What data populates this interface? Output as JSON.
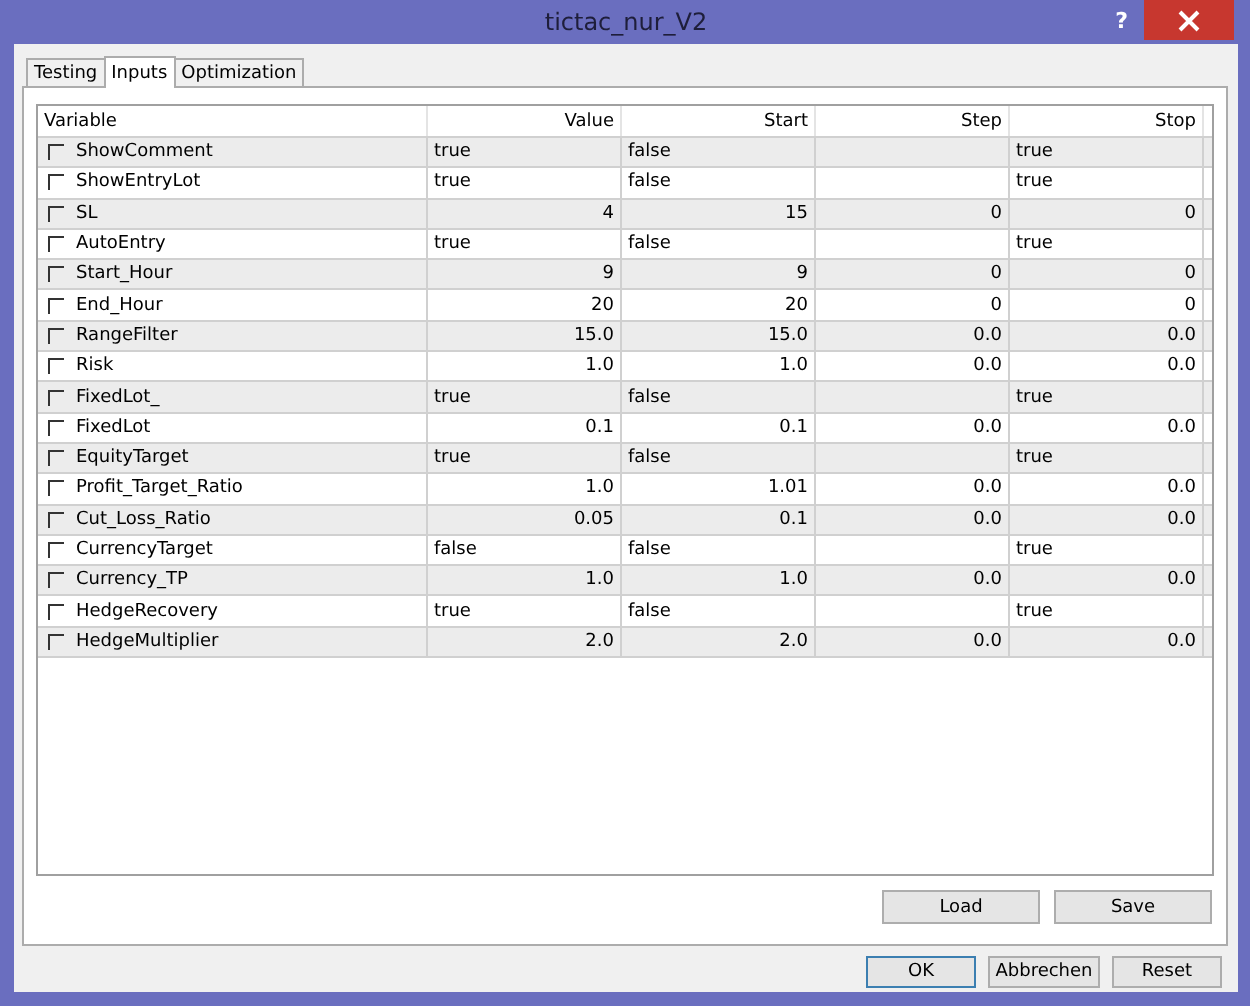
{
  "window": {
    "title": "tictac_nur_V2",
    "help": "?"
  },
  "tabs": [
    {
      "label": "Testing",
      "selected": false
    },
    {
      "label": "Inputs",
      "selected": true
    },
    {
      "label": "Optimization",
      "selected": false
    }
  ],
  "table": {
    "columns": [
      "Variable",
      "Value",
      "Start",
      "Step",
      "Stop"
    ],
    "rows": [
      {
        "kind": "bool",
        "checked": false,
        "variable": "ShowComment",
        "value": "true",
        "start": "false",
        "stop": "true"
      },
      {
        "kind": "bool",
        "checked": false,
        "variable": "ShowEntryLot",
        "value": "true",
        "start": "false",
        "stop": "true"
      },
      {
        "kind": "number",
        "checked": false,
        "variable": "SL",
        "value": "4",
        "start": "15",
        "step": "0",
        "stop": "0"
      },
      {
        "kind": "bool",
        "checked": false,
        "variable": "AutoEntry",
        "value": "true",
        "start": "false",
        "stop": "true"
      },
      {
        "kind": "number",
        "checked": false,
        "variable": "Start_Hour",
        "value": "9",
        "start": "9",
        "step": "0",
        "stop": "0"
      },
      {
        "kind": "number",
        "checked": false,
        "variable": "End_Hour",
        "value": "20",
        "start": "20",
        "step": "0",
        "stop": "0"
      },
      {
        "kind": "number",
        "checked": false,
        "variable": "RangeFilter",
        "value": "15.0",
        "start": "15.0",
        "step": "0.0",
        "stop": "0.0"
      },
      {
        "kind": "number",
        "checked": false,
        "variable": "Risk",
        "value": "1.0",
        "start": "1.0",
        "step": "0.0",
        "stop": "0.0"
      },
      {
        "kind": "bool",
        "checked": false,
        "variable": "FixedLot_",
        "value": "true",
        "start": "false",
        "stop": "true"
      },
      {
        "kind": "number",
        "checked": false,
        "variable": "FixedLot",
        "value": "0.1",
        "start": "0.1",
        "step": "0.0",
        "stop": "0.0"
      },
      {
        "kind": "bool",
        "checked": false,
        "variable": "EquityTarget",
        "value": "true",
        "start": "false",
        "stop": "true"
      },
      {
        "kind": "number",
        "checked": false,
        "variable": "Profit_Target_Ratio",
        "value": "1.0",
        "start": "1.01",
        "step": "0.0",
        "stop": "0.0"
      },
      {
        "kind": "number",
        "checked": false,
        "variable": "Cut_Loss_Ratio",
        "value": "0.05",
        "start": "0.1",
        "step": "0.0",
        "stop": "0.0"
      },
      {
        "kind": "bool",
        "checked": false,
        "variable": "CurrencyTarget",
        "value": "false",
        "start": "false",
        "stop": "true"
      },
      {
        "kind": "number",
        "checked": false,
        "variable": "Currency_TP",
        "value": "1.0",
        "start": "1.0",
        "step": "0.0",
        "stop": "0.0"
      },
      {
        "kind": "bool",
        "checked": false,
        "variable": "HedgeRecovery",
        "value": "true",
        "start": "false",
        "stop": "true"
      },
      {
        "kind": "number",
        "checked": false,
        "variable": "HedgeMultiplier",
        "value": "2.0",
        "start": "2.0",
        "step": "0.0",
        "stop": "0.0"
      }
    ]
  },
  "panel_buttons": [
    "Load",
    "Save"
  ],
  "dialog_buttons": [
    {
      "label": "OK",
      "default": true
    },
    {
      "label": "Abbrechen",
      "default": false
    },
    {
      "label": "Reset",
      "default": false
    }
  ]
}
